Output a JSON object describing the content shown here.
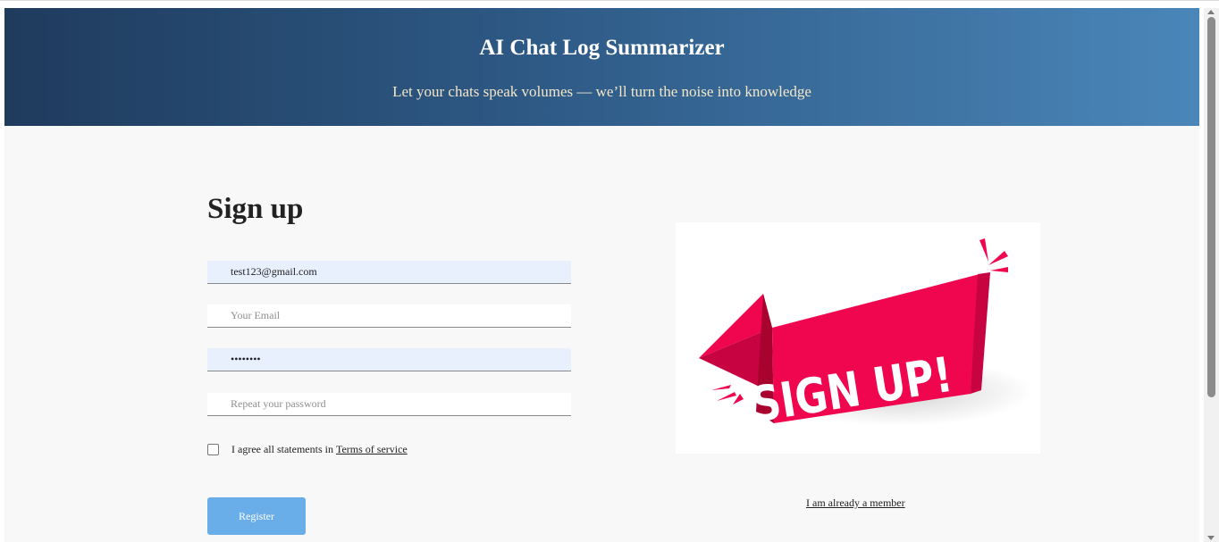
{
  "header": {
    "title": "AI Chat Log Summarizer",
    "tagline": "Let your chats speak volumes — we’ll turn the noise into knowledge"
  },
  "form": {
    "title": "Sign up",
    "name_value": "test123@gmail.com",
    "email_placeholder": "Your Email",
    "password_value": "••••••••",
    "repeat_placeholder": "Repeat your password",
    "agree_text": "I agree all statements in ",
    "terms_link": "Terms of service",
    "register_label": "Register"
  },
  "aside": {
    "banner_text": "SIGN UP!",
    "member_link": "I am already a member"
  },
  "colors": {
    "header_start": "#1f3b5d",
    "header_end": "#4a86b9",
    "tagline": "#f3e7c9",
    "button": "#6aaee9",
    "banner": "#f0064f"
  }
}
